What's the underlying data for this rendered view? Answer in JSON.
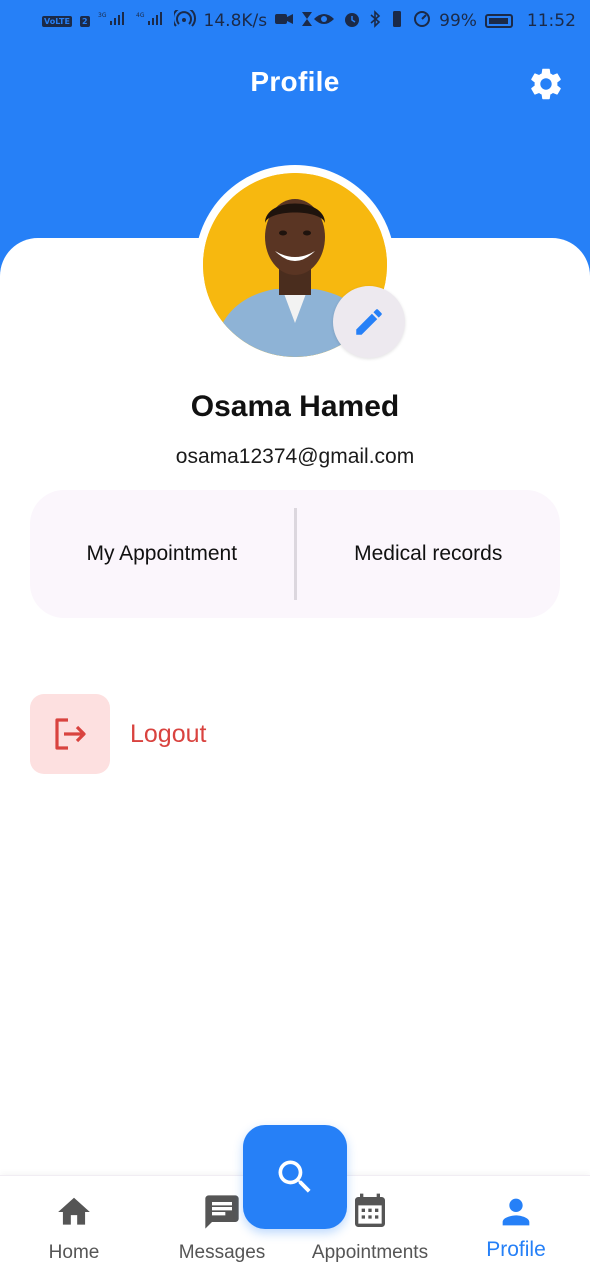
{
  "status_bar": {
    "volte_badge": "VoLTE",
    "sim_slot": "2",
    "network_3g": "3G",
    "network_4g": "4G",
    "speed": "14.8K/s",
    "battery_percent": "99%",
    "time": "11:52"
  },
  "header": {
    "title": "Profile",
    "settings_icon": "gear-icon"
  },
  "profile": {
    "name": "Osama Hamed",
    "email": "osama12374@gmail.com",
    "avatar_icon": "person-photo",
    "edit_icon": "pencil-icon"
  },
  "quick_links": {
    "appointments_label": "My Appointment",
    "records_label": "Medical records"
  },
  "logout": {
    "label": "Logout",
    "icon": "logout-icon"
  },
  "bottom_nav": {
    "items": [
      {
        "label": "Home",
        "icon": "home-icon"
      },
      {
        "label": "Messages",
        "icon": "message-icon"
      },
      {
        "label": "Appointments",
        "icon": "calendar-icon"
      },
      {
        "label": "Profile",
        "icon": "person-icon"
      }
    ],
    "active_index": 3,
    "fab_icon": "search-icon"
  },
  "colors": {
    "primary": "#2680f7",
    "logout_red": "#d9433f",
    "logout_bg": "#fde0e0",
    "panel_bg": "#fbf6fc",
    "avatar_bg": "#f7b80f"
  }
}
